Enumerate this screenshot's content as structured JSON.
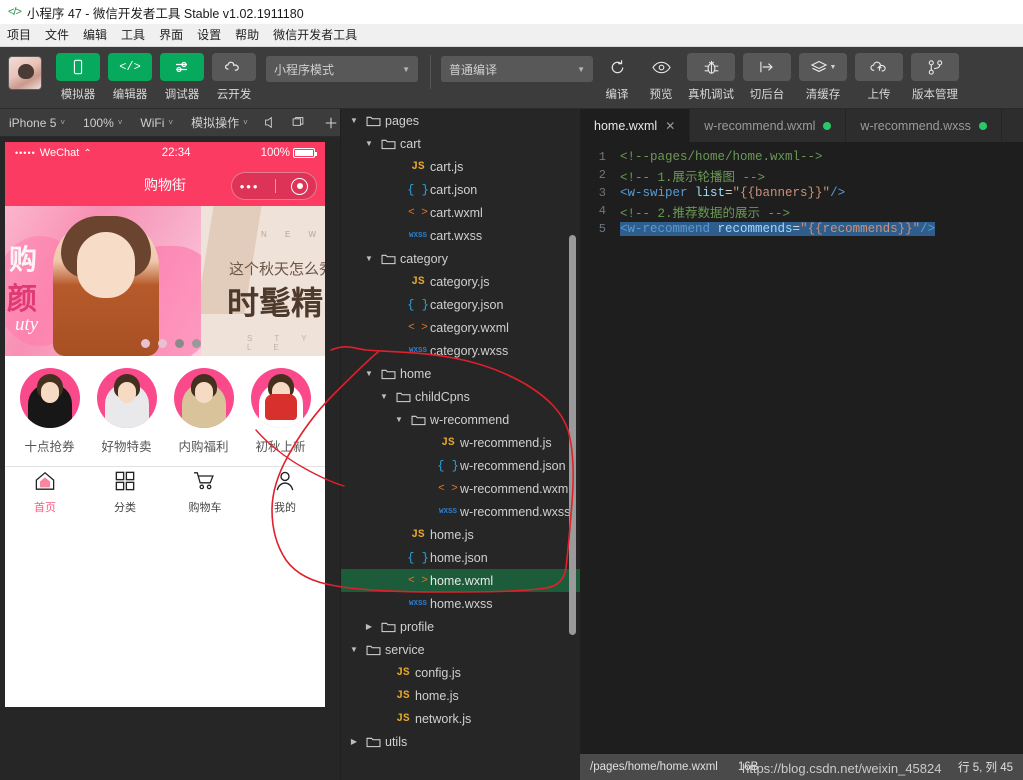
{
  "window": {
    "title": "小程序 47 - 微信开发者工具 Stable v1.02.1911180",
    "logo_icon": "code-brackets-icon"
  },
  "menubar": {
    "items": [
      "项目",
      "文件",
      "编辑",
      "工具",
      "界面",
      "设置",
      "帮助",
      "微信开发者工具"
    ]
  },
  "toolbar": {
    "avatar_label": "user-avatar",
    "buttons": [
      {
        "label": "模拟器",
        "icon": "phone-icon",
        "style": "green"
      },
      {
        "label": "编辑器",
        "icon": "code-icon",
        "style": "green"
      },
      {
        "label": "调试器",
        "icon": "sliders-icon",
        "style": "green"
      },
      {
        "label": "云开发",
        "icon": "cloud-icon",
        "style": "grey"
      }
    ],
    "mode_select": "小程序模式",
    "compile_select": "普通编译",
    "actions": [
      {
        "label": "编译",
        "icon": "refresh-icon",
        "filled": false
      },
      {
        "label": "预览",
        "icon": "eye-icon",
        "filled": false
      },
      {
        "label": "真机调试",
        "icon": "bug-icon",
        "filled": true
      },
      {
        "label": "切后台",
        "icon": "background-icon",
        "filled": true
      },
      {
        "label": "清缓存",
        "icon": "layers-icon",
        "filled": true
      },
      {
        "label": "上传",
        "icon": "upload-cloud-icon",
        "filled": true
      },
      {
        "label": "版本管理",
        "icon": "branch-icon",
        "filled": true
      }
    ]
  },
  "simulator_bar": {
    "device": "iPhone 5",
    "zoom": "100%",
    "network": "WiFi",
    "mock": "模拟操作",
    "icons": [
      "volume-icon",
      "rotate-screen-icon",
      "plus-icon",
      "search-icon",
      "more-icon",
      "list-icon",
      "panel-toggle-icon"
    ]
  },
  "phone": {
    "status": {
      "carrier": "WeChat",
      "signal_dots": "•••••",
      "wifi_icon": "wifi-icon",
      "time": "22:34",
      "battery": "100%"
    },
    "nav_title": "购物街",
    "capsule": {
      "more_icon": "more-dots-icon",
      "target_icon": "target-icon"
    },
    "banner_1": {
      "cn_char_1": "购",
      "cn_char_2": "颜",
      "script": "uty"
    },
    "banner_2": {
      "top_letters": "N E W",
      "line1": "这个秋天怎么秀?",
      "line2": "时髦精",
      "bottom_letters": "S T Y L E"
    },
    "recommends": [
      "十点抢券",
      "好物特卖",
      "内购福利",
      "初秋上新"
    ],
    "tabbar": [
      {
        "label": "首页",
        "icon": "home-icon",
        "active": true
      },
      {
        "label": "分类",
        "icon": "grid-icon",
        "active": false
      },
      {
        "label": "购物车",
        "icon": "cart-icon",
        "active": false
      },
      {
        "label": "我的",
        "icon": "person-icon",
        "active": false
      }
    ]
  },
  "explorer": {
    "tree": [
      {
        "label": "pages",
        "indent": 1,
        "kind": "folder",
        "open": true
      },
      {
        "label": "cart",
        "indent": 2,
        "kind": "folder",
        "open": true
      },
      {
        "label": "cart.js",
        "indent": 4,
        "kind": "js"
      },
      {
        "label": "cart.json",
        "indent": 4,
        "kind": "json"
      },
      {
        "label": "cart.wxml",
        "indent": 4,
        "kind": "wxml"
      },
      {
        "label": "cart.wxss",
        "indent": 4,
        "kind": "wxss"
      },
      {
        "label": "category",
        "indent": 2,
        "kind": "folder",
        "open": true
      },
      {
        "label": "category.js",
        "indent": 4,
        "kind": "js"
      },
      {
        "label": "category.json",
        "indent": 4,
        "kind": "json"
      },
      {
        "label": "category.wxml",
        "indent": 4,
        "kind": "wxml"
      },
      {
        "label": "category.wxss",
        "indent": 4,
        "kind": "wxss"
      },
      {
        "label": "home",
        "indent": 2,
        "kind": "folder",
        "open": true
      },
      {
        "label": "childCpns",
        "indent": 3,
        "kind": "folder",
        "open": true
      },
      {
        "label": "w-recommend",
        "indent": 4,
        "kind": "folder",
        "open": true
      },
      {
        "label": "w-recommend.js",
        "indent": 6,
        "kind": "js"
      },
      {
        "label": "w-recommend.json",
        "indent": 6,
        "kind": "json"
      },
      {
        "label": "w-recommend.wxml",
        "indent": 6,
        "kind": "wxml"
      },
      {
        "label": "w-recommend.wxss",
        "indent": 6,
        "kind": "wxss"
      },
      {
        "label": "home.js",
        "indent": 4,
        "kind": "js"
      },
      {
        "label": "home.json",
        "indent": 4,
        "kind": "json"
      },
      {
        "label": "home.wxml",
        "indent": 4,
        "kind": "wxml",
        "selected": true
      },
      {
        "label": "home.wxss",
        "indent": 4,
        "kind": "wxss"
      },
      {
        "label": "profile",
        "indent": 2,
        "kind": "folder",
        "open": false
      },
      {
        "label": "service",
        "indent": 1,
        "kind": "folder",
        "open": true
      },
      {
        "label": "config.js",
        "indent": 3,
        "kind": "js"
      },
      {
        "label": "home.js",
        "indent": 3,
        "kind": "js"
      },
      {
        "label": "network.js",
        "indent": 3,
        "kind": "js"
      },
      {
        "label": "utils",
        "indent": 1,
        "kind": "folder",
        "open": false
      }
    ]
  },
  "editor": {
    "tabs": [
      {
        "label": "home.wxml",
        "active": true,
        "close_icon": "close-icon",
        "modified": false
      },
      {
        "label": "w-recommend.wxml",
        "active": false,
        "modified": true
      },
      {
        "label": "w-recommend.wxss",
        "active": false,
        "modified": true
      }
    ],
    "lines": [
      {
        "n": "1",
        "tokens": [
          {
            "t": "<!--pages/home/home.wxml-->",
            "c": "cm"
          }
        ]
      },
      {
        "n": "2",
        "tokens": [
          {
            "t": "<!-- 1.展示轮播图 -->",
            "c": "cm"
          }
        ]
      },
      {
        "n": "3",
        "tokens": [
          {
            "t": "<w-swiper ",
            "c": "tg"
          },
          {
            "t": "list",
            "c": "at"
          },
          {
            "t": "=",
            "c": "pl"
          },
          {
            "t": "\"{{banners}}\"",
            "c": "st"
          },
          {
            "t": "/>",
            "c": "tg"
          }
        ]
      },
      {
        "n": "4",
        "tokens": [
          {
            "t": "<!-- 2.推荐数据的展示 -->",
            "c": "cm"
          }
        ]
      },
      {
        "n": "5",
        "highlight": true,
        "tokens": [
          {
            "t": "<w-recommend ",
            "c": "tg"
          },
          {
            "t": "recommends",
            "c": "at"
          },
          {
            "t": "=",
            "c": "pl"
          },
          {
            "t": "\"{{recommends}}\"",
            "c": "st"
          },
          {
            "t": "/>",
            "c": "tg"
          }
        ]
      }
    ]
  },
  "status_bar": {
    "path": "/pages/home/home.wxml",
    "size": "16B",
    "position": "行 5, 列 45",
    "watermark": "https://blog.csdn.net/weixin_45824"
  },
  "colors": {
    "accent_green": "#07a95c",
    "selection_green": "#1d5c3a",
    "phone_pink": "#fb3b62",
    "annotation_red": "#e0202a",
    "modified_dot": "#2ac769"
  }
}
